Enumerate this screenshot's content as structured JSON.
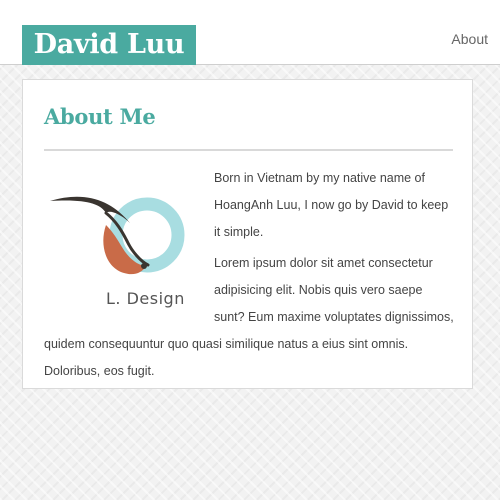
{
  "header": {
    "site_title": "David Luu",
    "nav": {
      "about_label": "About"
    }
  },
  "main": {
    "title": "About Me",
    "paragraphs": [
      "Born in Vietnam by my native name of HoangAnh Luu, I now go by David to keep it simple.",
      "Lorem ipsum dolor sit amet consectetur adipisicing elit. Nobis quis vero saepe sunt? Eum maxime voluptates dignissimos, quidem consequuntur quo quasi similique natus a eius sint omnis. Doloribus, eos fugit."
    ],
    "logo": {
      "text": "L. Design",
      "icon": "bird-ring-logo",
      "colors": {
        "ring": "#a8dde1",
        "bird": "#c96b48",
        "beak": "#3a3530",
        "text": "#555555"
      }
    }
  },
  "theme": {
    "accent": "#4aaaa0",
    "header_bg": "#ffffff",
    "page_bg": "#f2f2f2",
    "text": "#444444"
  }
}
